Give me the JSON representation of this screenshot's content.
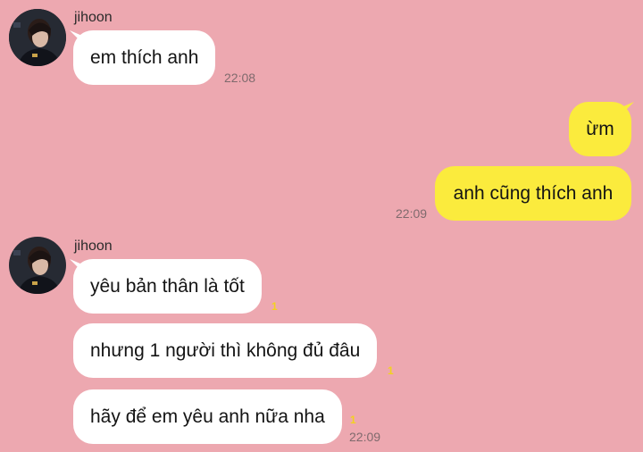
{
  "colors": {
    "background": "#eda8b0",
    "incoming_bubble": "#ffffff",
    "outgoing_bubble": "#fbeb3d",
    "unread": "#f2d21e"
  },
  "groups": [
    {
      "sender": "jihoon",
      "messages": [
        {
          "text": "em thích anh",
          "time": "22:08"
        }
      ]
    },
    {
      "sender": "me",
      "messages": [
        {
          "text": "ừm"
        },
        {
          "text": "anh cũng thích anh",
          "time": "22:09"
        }
      ]
    },
    {
      "sender": "jihoon",
      "messages": [
        {
          "text": "yêu bản thân là tốt",
          "unread": "1"
        },
        {
          "text": "nhưng 1 người thì không đủ đâu",
          "unread": "1"
        },
        {
          "text": "hãy để em yêu anh nữa nha",
          "unread": "1",
          "time": "22:09"
        }
      ]
    }
  ]
}
